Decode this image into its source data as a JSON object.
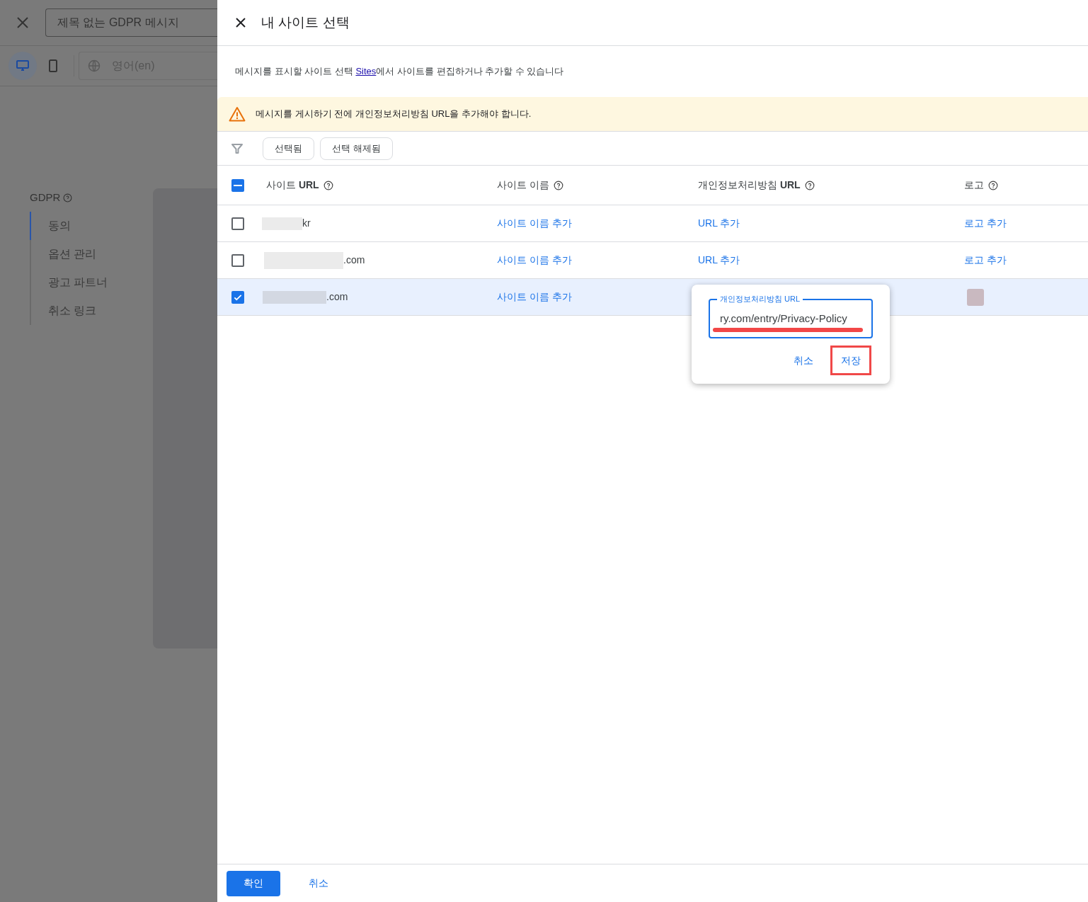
{
  "background": {
    "title_field": {
      "value": "제목 없는 GDPR 메시지"
    },
    "device_toggles": [
      {
        "kind": "desktop",
        "selected": true
      },
      {
        "kind": "mobile",
        "selected": false
      }
    ],
    "language_field": {
      "value": "영어(en)"
    },
    "nav": {
      "heading": "GDPR",
      "items": [
        {
          "label": "동의",
          "selected": true
        },
        {
          "label": "옵션 관리",
          "selected": false
        },
        {
          "label": "광고 파트너",
          "selected": false
        },
        {
          "label": "취소 링크",
          "selected": false
        }
      ]
    }
  },
  "panel": {
    "title": "내 사이트 선택",
    "description": {
      "before": "메시지를 표시할 사이트 선택 ",
      "link": "Sites",
      "after": "에서 사이트를 편집하거나 추가할 수 있습니다"
    },
    "warning": "메시지를 게시하기 전에 개인정보처리방침 URL을 추가해야 합니다.",
    "filters": [
      {
        "label": "선택됨"
      },
      {
        "label": "선택 해제됨"
      }
    ],
    "table": {
      "header_checkbox": {
        "indeterminate": true
      },
      "columns": [
        {
          "label": "사이트 **URL**"
        },
        {
          "label": "사이트 이름"
        },
        {
          "label": "개인정보처리방침 **URL**"
        },
        {
          "label": "로고"
        }
      ],
      "rows": [
        {
          "checked": false,
          "url_suffix": "kr",
          "site_name": "사이트 이름 추가",
          "privacy": {
            "kind": "link",
            "text": "URL 추가"
          },
          "logo": {
            "kind": "link",
            "text": "로고 추가"
          }
        },
        {
          "checked": false,
          "url_suffix": ".com",
          "site_name": "사이트 이름 추가",
          "privacy": {
            "kind": "link",
            "text": "URL 추가"
          },
          "logo": {
            "kind": "link",
            "text": "로고 추가"
          }
        },
        {
          "checked": true,
          "url_suffix": ".com",
          "site_name": "사이트 이름 추가",
          "privacy": {
            "kind": "editor",
            "label": "개인정보처리방침 URL",
            "value": "ry.com/entry/Privacy-Policy",
            "buttons": [
              {
                "label": "취소",
                "highlighted": false
              },
              {
                "label": "저장",
                "highlighted": true
              }
            ]
          },
          "logo": {
            "kind": "image"
          }
        }
      ]
    }
  },
  "footer": {
    "buttons": [
      {
        "label": "확인",
        "kind": "primary"
      },
      {
        "label": "취소",
        "kind": "text"
      }
    ]
  }
}
